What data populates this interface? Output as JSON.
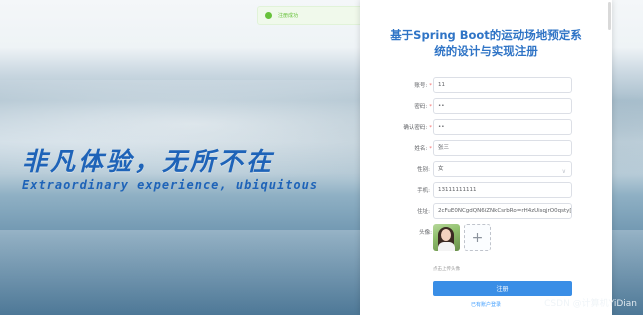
{
  "background": {
    "headline": "非凡体验，无所不在",
    "subline": "Extraordinary experience, ubiquitous"
  },
  "toast": {
    "message": "注册成功"
  },
  "form": {
    "title_line1": "基于Spring Boot的运动场地预定系",
    "title_line2": "统的设计与实现注册",
    "fields": [
      {
        "label": "账号:",
        "required": "*",
        "value": "11"
      },
      {
        "label": "密码:",
        "required": "*",
        "value": "••"
      },
      {
        "label": "确认密码:",
        "required": "*",
        "value": "••"
      },
      {
        "label": "姓名:",
        "required": "*",
        "value": "张三"
      },
      {
        "label": "性别:",
        "required": "",
        "value": "女"
      },
      {
        "label": "手机:",
        "required": "",
        "value": "13111111111"
      },
      {
        "label": "住址:",
        "required": "",
        "value": "2cFuE0NCgdQN6iZNkCsrbRo=rH4zUisqjrO0qsty[]Uk="
      }
    ],
    "avatar_label": "头像:",
    "upload_hint": "点击上传头像",
    "submit_label": "注册",
    "login_link": "已有账户登录"
  },
  "watermark": "CSDN @计算机YiDian"
}
